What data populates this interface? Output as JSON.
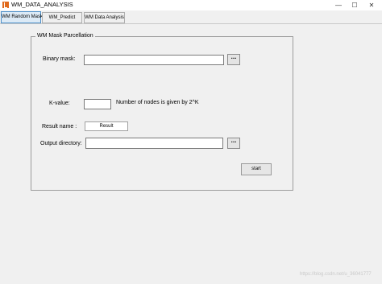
{
  "window": {
    "title": "WM_DATA_ANALYSIS",
    "controls": {
      "minimize": "—",
      "maximize": "☐",
      "close": "✕"
    }
  },
  "tabs": [
    {
      "label": "WM Random Mask"
    },
    {
      "label": "WM_Predict"
    },
    {
      "label": "WM Data Analysis"
    }
  ],
  "panel": {
    "title": "WM Mask Parcellation",
    "binary_mask_label": "Binary mask:",
    "binary_mask_value": "",
    "binary_browse": "...",
    "k_value_label": "K-value:",
    "k_value": "",
    "k_note": "Number of nodes is given by 2^K",
    "result_name_label": "Result name :",
    "result_name_value": "Result",
    "output_dir_label": "Output directory:",
    "output_dir_value": "",
    "output_browse": "...",
    "start_label": "start"
  },
  "watermark": "https://blog.csdn.net/u_36041777"
}
